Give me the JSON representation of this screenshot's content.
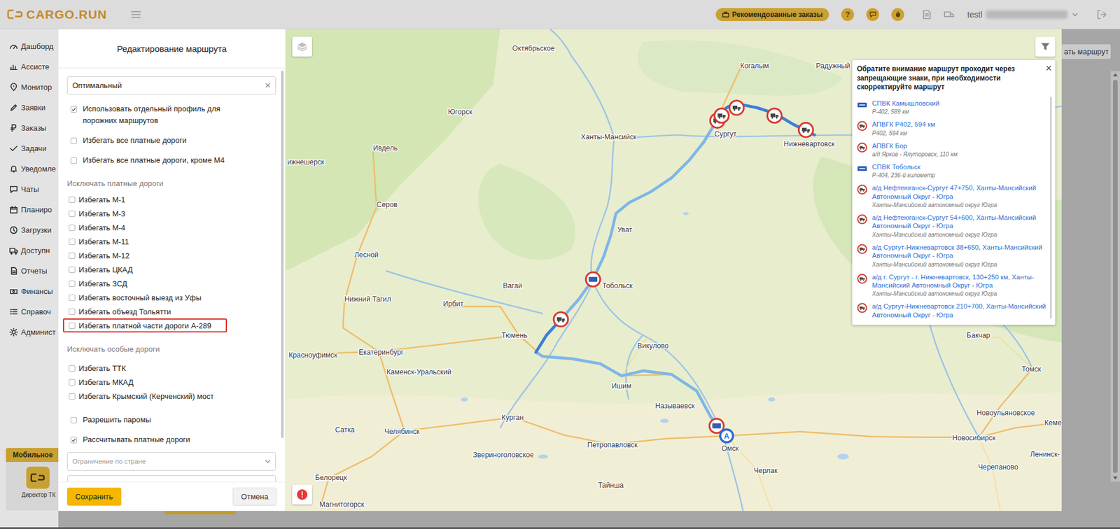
{
  "header": {
    "logo": "CARGO.RUN",
    "recommended": "Рекомендованные заказы",
    "help": "?",
    "user": "testl"
  },
  "sidebar": {
    "items": [
      {
        "label": "Дашборд"
      },
      {
        "label": "Ассисте"
      },
      {
        "label": "Монитор"
      },
      {
        "label": "Заявки"
      },
      {
        "label": "Заказы"
      },
      {
        "label": "Задачи"
      },
      {
        "label": "Уведомле"
      },
      {
        "label": "Чаты"
      },
      {
        "label": "Планиро"
      },
      {
        "label": "Загрузки"
      },
      {
        "label": "Доступн"
      },
      {
        "label": "Отчеты"
      },
      {
        "label": "Финансы"
      },
      {
        "label": "Справоч"
      },
      {
        "label": "Админист"
      }
    ],
    "mobile": {
      "title": "Мобильное",
      "caption": "Директор ТК"
    }
  },
  "page": {
    "button": "ать маршрут"
  },
  "modal": {
    "title": "Редактирование маршрута",
    "profile": {
      "value": "Оптимальный",
      "clear": "×"
    },
    "options": [
      {
        "label": "Использовать отдельный профиль для порожних маршрутов",
        "checked": true
      },
      {
        "label": "Избегать все платные дороги",
        "checked": false
      },
      {
        "label": "Избегать все платные дороги, кроме М4",
        "checked": false
      }
    ],
    "sections": [
      {
        "title": "Исключать платные дороги",
        "items": [
          {
            "label": "Избегать М-1",
            "checked": false,
            "highlighted": false
          },
          {
            "label": "Избегать М-3",
            "checked": false,
            "highlighted": false
          },
          {
            "label": "Избегать М-4",
            "checked": false,
            "highlighted": false
          },
          {
            "label": "Избегать М-11",
            "checked": false,
            "highlighted": false
          },
          {
            "label": "Избегать М-12",
            "checked": false,
            "highlighted": false
          },
          {
            "label": "Избегать ЦКАД",
            "checked": false,
            "highlighted": false
          },
          {
            "label": "Избегать ЗСД",
            "checked": false,
            "highlighted": false
          },
          {
            "label": "Избегать восточный выезд из Уфы",
            "checked": false,
            "highlighted": false
          },
          {
            "label": "Избегать объезд Тольятти",
            "checked": false,
            "highlighted": false
          },
          {
            "label": "Избегать платной части дороги А-289",
            "checked": false,
            "highlighted": true
          }
        ]
      },
      {
        "title": "Исключать особые дороги",
        "items": [
          {
            "label": "Избегать ТТК",
            "checked": false,
            "highlighted": false
          },
          {
            "label": "Избегать МКАД",
            "checked": false,
            "highlighted": false
          },
          {
            "label": "Избегать Крымский (Керченский) мост",
            "checked": false,
            "highlighted": false
          }
        ]
      }
    ],
    "extra_options": [
      {
        "label": "Разрешить паромы",
        "checked": false
      },
      {
        "label": "Рассчитывать платные дороги",
        "checked": true
      }
    ],
    "country": {
      "placeholder": "Ограничение по стране"
    },
    "buttons": [
      {
        "label": "Сохранить",
        "kind": "primary"
      },
      {
        "label": "Отмена",
        "kind": "secondary"
      }
    ]
  },
  "map": {
    "labels": [
      "Октябрьское",
      "Когалым",
      "Радужный",
      "Югорск",
      "Ханты-Мансийск",
      "Сургут",
      "Нижневартовск",
      "Ивдель",
      "ижнешерск",
      "Серов",
      "Уват",
      "Лесной",
      "Нижний Тагил",
      "Ирбит",
      "Вагай",
      "Тобольск",
      "Тюмень",
      "Екатеринбург",
      "Красноуфимск",
      "Каменск-Уральский",
      "Викулово",
      "Ишим",
      "Называевск",
      "Курган",
      "Челябинск",
      "Сатка",
      "Петропавловск",
      "Звериноголовское",
      "Новоульяновское",
      "Новосибирск",
      "Томск",
      "Кеме",
      "Ленинск-",
      "Бакчар",
      "Черепаново",
      "Черлак",
      "Тайнша",
      "Белорецк",
      "Магнитогорск",
      "Омск"
    ],
    "marker_a": "A"
  },
  "warning": {
    "title": "Обратите внимание маршрут проходит через запрещающие знаки, при необходимости скорректируйте маршрут",
    "close": "×",
    "items": [
      {
        "kind": "spvk",
        "title": "СПВК Камышловский",
        "subtitle": "Р-402, 589 км"
      },
      {
        "kind": "apvgk",
        "title": "АПВГК Р402, 594 км",
        "subtitle": "Р402, 594 км"
      },
      {
        "kind": "apvgk",
        "title": "АПВГК Бор",
        "subtitle": "а/д Ярков - Ялуторовск, 110 км"
      },
      {
        "kind": "spvk",
        "title": "СПВК Тобольск",
        "subtitle": "Р-404, 236-й километр"
      },
      {
        "kind": "apvgk",
        "title": "а/д Нефтеюганск-Сургут 47+750, Ханты-Мансийский Автономный Округ - Югра",
        "subtitle": "Ханты-Мансийский автономный округ Югра"
      },
      {
        "kind": "apvgk",
        "title": "а/д Нефтеюганск-Сургут 54+600, Ханты-Мансийский Автономный Округ - Югра",
        "subtitle": "Ханты-Мансийский автономный округ Югра"
      },
      {
        "kind": "apvgk",
        "title": "а/д Сургут-Нижневартовск 38+650, Ханты-Мансийский Автономный Округ - Югра",
        "subtitle": "Ханты-Мансийский автономный округ Югра"
      },
      {
        "kind": "apvgk",
        "title": "а/д г. Сургут - г. Нижневартовск, 130+250 км, Ханты-Мансийский Автономный Округ - Югра",
        "subtitle": "Ханты-Мансийский автономный округ Югра"
      },
      {
        "kind": "apvgk",
        "title": "а/д Сургут-Нижневартовск 210+700, Ханты-Мансийский Автономный Округ - Югра"
      }
    ]
  }
}
